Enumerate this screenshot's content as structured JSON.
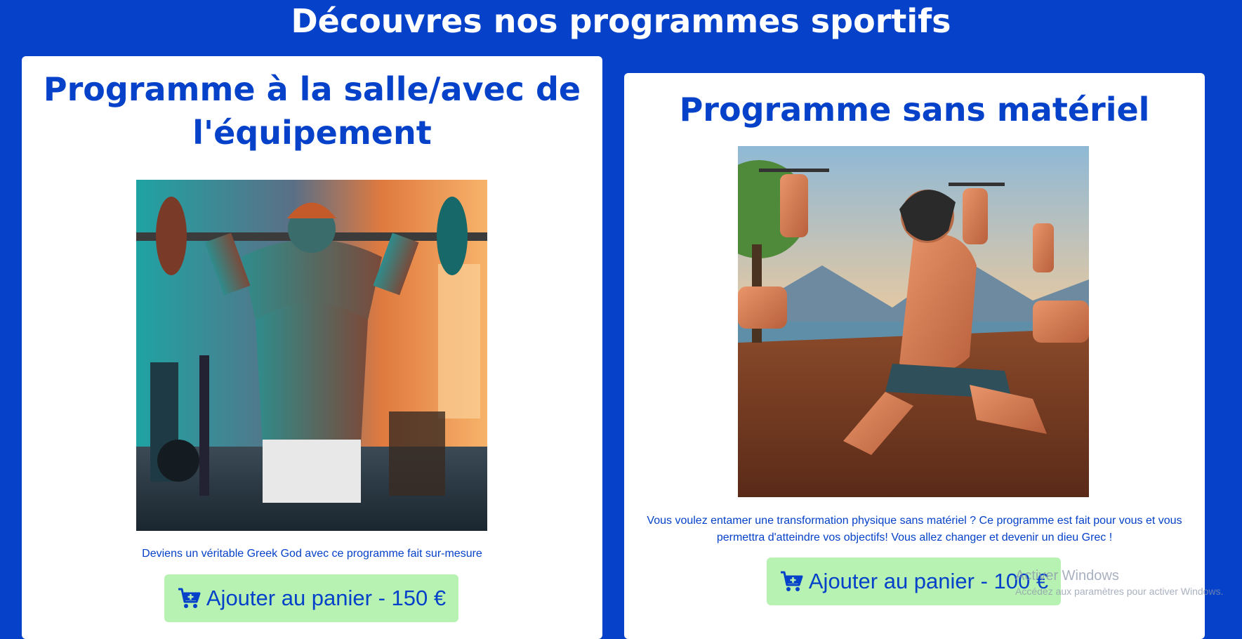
{
  "header": {
    "title": "Découvres nos programmes sportifs"
  },
  "programs": [
    {
      "title_line1": "Programme à la salle/avec de",
      "title_line2": "l'équipement",
      "image_icon": "gym-lifter-illustration",
      "description": "Deviens un véritable Greek God avec ce programme fait sur-mesure",
      "button_label": "Ajouter au panier - 150 €",
      "button_icon": "cart-add-icon"
    },
    {
      "title_line1": "Programme sans matériel",
      "image_icon": "outdoor-workout-illustration",
      "description": "Vous voulez entamer une transformation physique sans matériel ? Ce programme est fait pour vous et vous permettra d'atteindre vos objectifs! Vous allez changer et devenir un dieu Grec !",
      "button_label": "Ajouter au panier - 100 €",
      "button_icon": "cart-add-icon"
    }
  ],
  "watermark": {
    "title": "Activer Windows",
    "subtitle": "Accédez aux paramètres pour activer Windows."
  },
  "colors": {
    "background": "#0542c9",
    "accent_text": "#0542c9",
    "button_bg": "#b7f2b3",
    "card_bg": "#ffffff"
  }
}
